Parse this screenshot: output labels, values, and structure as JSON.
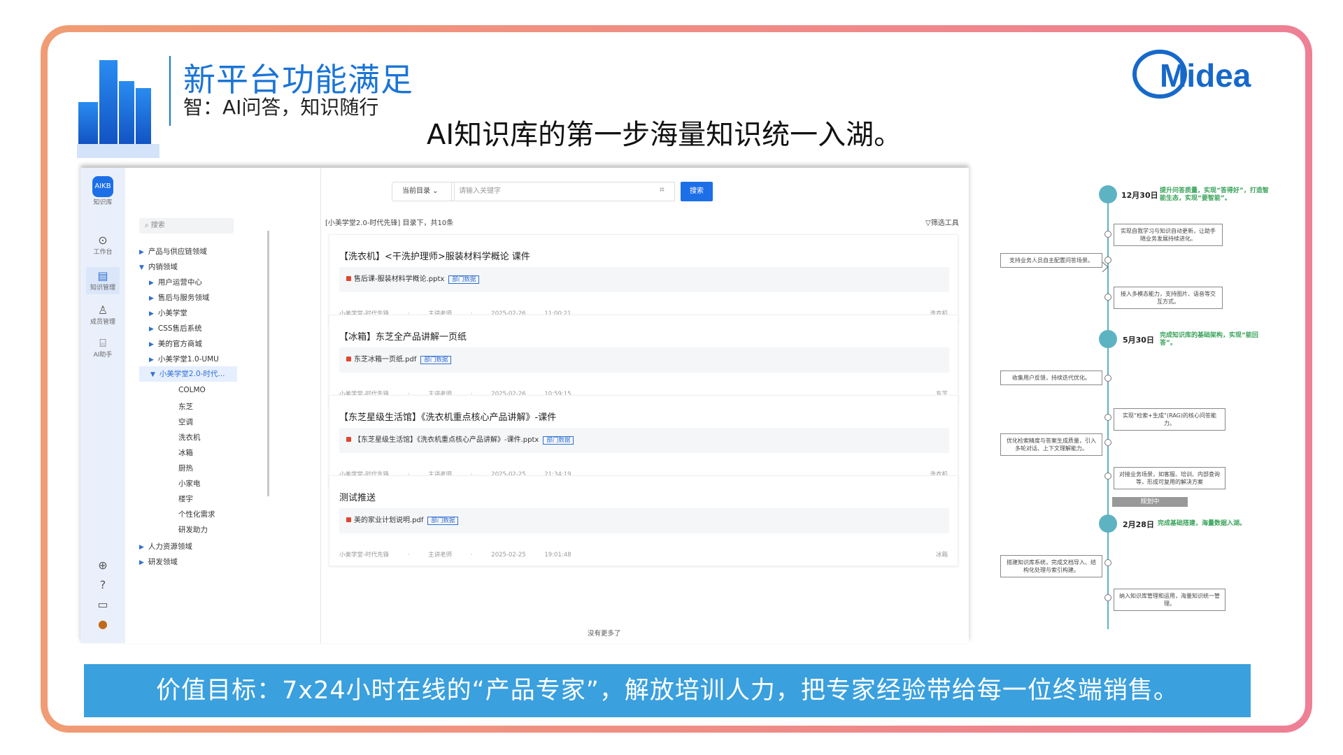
{
  "slide": {
    "title": "新平台功能满足",
    "subtitle": "智：AI问答，知识随行",
    "headline": "AI知识库的第一步海量知识统一入湖。",
    "brand": "Midea",
    "banner": "价值目标：7x24小时在线的“产品专家”，解放培训人力，把专家经验带给每一位终端销售。"
  },
  "app": {
    "rail": [
      {
        "label": "知识库",
        "icon": "knowledge-base-icon"
      },
      {
        "label": "工作台",
        "icon": "workbench-icon"
      },
      {
        "label": "知识管理",
        "icon": "knowledge-manage-icon"
      },
      {
        "label": "成员管理",
        "icon": "members-icon"
      },
      {
        "label": "AI助手",
        "icon": "ai-assistant-icon"
      }
    ],
    "rail_bottom_icons": [
      "globe-icon",
      "help-icon",
      "message-icon",
      "avatar"
    ],
    "tree_search_placeholder": "搜索",
    "tree": [
      "产品与供应链领域",
      "内销领域",
      "用户运营中心",
      "售后与服务领域",
      "小美学堂",
      "CSS售后系统",
      "美的官方商城",
      "小美学堂1.0-UMU",
      "小美学堂2.0-时代...",
      "COLMO",
      "东芝",
      "空调",
      "洗衣机",
      "冰箱",
      "厨热",
      "小家电",
      "楼宇",
      "个性化需求",
      "研发助力",
      "人力资源领域",
      "研发领域"
    ],
    "search": {
      "scope": "当前目录",
      "placeholder": "请输入关键字",
      "button": "搜索"
    },
    "result_summary": "[小美学堂2.0-时代先锋] 目录下，共10条",
    "toolbar_right": "筛选工具",
    "cards": [
      {
        "title": "【洗衣机】<干洗护理师>服装材料学概论 课件",
        "file": "售后课-服装材料学概论.pptx",
        "tag": "部门数据",
        "meta": "小美学堂-时代先锋  ·  主讲老师  ·  2025-02-26 11:00:21",
        "meta_right": "洗衣机"
      },
      {
        "title": "【冰箱】东芝全产品讲解一页纸",
        "file": "东芝冰箱一页纸.pdf",
        "tag": "部门数据",
        "meta": "小美学堂-时代先锋  ·  主讲老师  ·  2025-02-26 10:59:15",
        "meta_right": "东芝"
      },
      {
        "title": "【东芝星级生活馆】《洗衣机重点核心产品讲解》-课件",
        "file": "【东芝星级生活馆】《洗衣机重点核心产品讲解》-课件.pptx",
        "tag": "部门数据",
        "meta": "小美学堂-时代先锋  ·  主讲老师  ·  2025-02-25 21:34:19",
        "meta_right": "洗衣机"
      },
      {
        "title": "测试推送",
        "file": "美的家业计划说明.pdf",
        "tag": "部门数据",
        "meta": "小美学堂-时代先锋  ·  主讲老师  ·  2025-02-25 19:01:48",
        "meta_right": "冰箱"
      }
    ],
    "no_more": "没有更多了"
  },
  "timeline": {
    "milestones": [
      {
        "date": "12月30日",
        "note": "提升问答质量，实现“答得好”，打造智能生态，实现“要智能”。"
      },
      {
        "date": "5月30日",
        "note": "完成知识库的基础架构，实现“能回答”。"
      },
      {
        "date": "2月28日",
        "note": "完成基础搭建，海量数据入湖。"
      }
    ],
    "items": [
      "实现自我学习与知识自动更新，让助手随业务发展持续进化。",
      "支持业务人员自主配置问答场景。",
      "接入多模态能力，支持图片、语音等交互方式。",
      "收集用户反馈，持续迭代优化。",
      "实现“检索+生成”(RAG)的核心问答能力。",
      "优化检索精度与答案生成质量，引入多轮对话、上下文理解能力。",
      "对接业务场景，如客服、培训、内部查询等，形成可复用的解决方案",
      "搭建知识库系统，完成文档导入、结构化处理与索引构建。",
      "纳入知识库管理和运用，海量知识统一管理。"
    ],
    "pending": "规划中",
    "color_accent": "#5eb3c2",
    "color_note": "#3aa35b"
  }
}
